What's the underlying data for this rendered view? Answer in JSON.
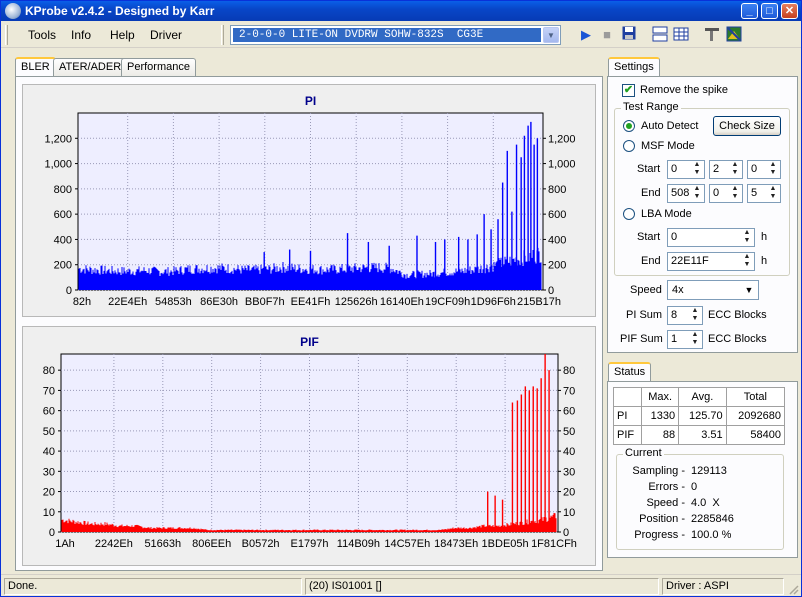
{
  "window": {
    "title": "KProbe v2.4.2 - Designed by Karr",
    "min": "_",
    "max": "□",
    "close": "✕"
  },
  "menu": {
    "items": [
      "Tools",
      "Info",
      "Help",
      "Driver"
    ]
  },
  "drive": {
    "selected": "2-0-0-0 LITE-ON DVDRW SOHW-832S  CG3E"
  },
  "toolbar": {
    "icons": [
      "play-icon",
      "stop-icon",
      "save-icon",
      "layout-icon",
      "grid-icon",
      "tools-icon",
      "image-icon"
    ]
  },
  "tabs": [
    "BLER",
    "ATER/ADER",
    "Performance"
  ],
  "chart_data": [
    {
      "type": "bar",
      "title": "PI",
      "x_tick_labels": [
        "82h",
        "22E4Eh",
        "54853h",
        "86E30h",
        "BB0F7h",
        "EE41Fh",
        "125626h",
        "16140Eh",
        "19CF09h",
        "1D96F6h",
        "215B17h"
      ],
      "ylim": [
        0,
        1400
      ],
      "y_ticks": [
        0,
        200,
        400,
        600,
        800,
        1000,
        1200
      ],
      "y_tick_labels": [
        "0",
        "200",
        "400",
        "600",
        "800",
        "1,000",
        "1,200"
      ],
      "color": "#0000FF",
      "baseline": [
        170,
        160,
        155,
        150,
        150,
        155,
        145,
        150,
        165,
        170,
        175,
        170,
        160,
        160,
        165,
        180,
        170,
        165,
        160,
        165,
        170,
        175,
        178,
        170,
        120,
        125,
        130,
        140,
        150,
        160,
        180,
        210,
        240,
        260,
        290
      ],
      "spikes": [
        {
          "x": 0.4,
          "v": 300
        },
        {
          "x": 0.455,
          "v": 320
        },
        {
          "x": 0.5,
          "v": 310
        },
        {
          "x": 0.58,
          "v": 450
        },
        {
          "x": 0.625,
          "v": 380
        },
        {
          "x": 0.67,
          "v": 350
        },
        {
          "x": 0.73,
          "v": 430
        },
        {
          "x": 0.77,
          "v": 380
        },
        {
          "x": 0.79,
          "v": 400
        },
        {
          "x": 0.82,
          "v": 420
        },
        {
          "x": 0.84,
          "v": 400
        },
        {
          "x": 0.86,
          "v": 440
        },
        {
          "x": 0.875,
          "v": 600
        },
        {
          "x": 0.89,
          "v": 480
        },
        {
          "x": 0.905,
          "v": 560
        },
        {
          "x": 0.915,
          "v": 850
        },
        {
          "x": 0.925,
          "v": 1100
        },
        {
          "x": 0.935,
          "v": 620
        },
        {
          "x": 0.945,
          "v": 1150
        },
        {
          "x": 0.955,
          "v": 1050
        },
        {
          "x": 0.962,
          "v": 1220
        },
        {
          "x": 0.97,
          "v": 1300
        },
        {
          "x": 0.976,
          "v": 1330
        },
        {
          "x": 0.983,
          "v": 1150
        },
        {
          "x": 0.99,
          "v": 1200
        }
      ]
    },
    {
      "type": "bar",
      "title": "PIF",
      "x_tick_labels": [
        "1Ah",
        "2242Eh",
        "51663h",
        "806EEh",
        "B0572h",
        "E1797h",
        "114B09h",
        "14C57Eh",
        "18473Eh",
        "1BDE05h",
        "1F81CFh"
      ],
      "ylim": [
        0,
        88
      ],
      "y_ticks": [
        0,
        10,
        20,
        30,
        40,
        50,
        60,
        70,
        80
      ],
      "y_tick_labels": [
        "0",
        "10",
        "20",
        "30",
        "40",
        "50",
        "60",
        "70",
        "80"
      ],
      "color": "#FF0000",
      "baseline": [
        6,
        5,
        4,
        4,
        3,
        3,
        2,
        2,
        2,
        2,
        1,
        1,
        1,
        1,
        1,
        1,
        1,
        1,
        1,
        1,
        1,
        1,
        1,
        1,
        1,
        1,
        1,
        2,
        2,
        3,
        3,
        4,
        5,
        6,
        8
      ],
      "spikes": [
        {
          "x": 0.86,
          "v": 20
        },
        {
          "x": 0.875,
          "v": 18
        },
        {
          "x": 0.89,
          "v": 16
        },
        {
          "x": 0.91,
          "v": 64
        },
        {
          "x": 0.92,
          "v": 65
        },
        {
          "x": 0.928,
          "v": 68
        },
        {
          "x": 0.936,
          "v": 72
        },
        {
          "x": 0.944,
          "v": 70
        },
        {
          "x": 0.952,
          "v": 72
        },
        {
          "x": 0.96,
          "v": 71
        },
        {
          "x": 0.968,
          "v": 76
        },
        {
          "x": 0.976,
          "v": 88
        },
        {
          "x": 0.984,
          "v": 80
        }
      ]
    }
  ],
  "settings": {
    "title": "Settings",
    "remove_spike": "Remove the spike",
    "test_range": "Test Range",
    "auto_detect": "Auto Detect",
    "check_size": "Check Size",
    "msf_mode": "MSF Mode",
    "start_label": "Start",
    "end_label": "End",
    "msf_start": [
      "0",
      "2",
      "0"
    ],
    "msf_end": [
      "508",
      "0",
      "5"
    ],
    "lba_mode": "LBA Mode",
    "lba_start": "0",
    "lba_end": "22E11F",
    "h": "h",
    "speed_label": "Speed",
    "speed_value": "4x",
    "pi_sum_label": "PI Sum",
    "pi_sum_value": "8",
    "pif_sum_label": "PIF Sum",
    "pif_sum_value": "1",
    "ecc_blocks": "ECC Blocks"
  },
  "status": {
    "title": "Status",
    "headers": [
      "",
      "Max.",
      "Avg.",
      "Total"
    ],
    "rows": [
      [
        "PI",
        "1330",
        "125.70",
        "2092680"
      ],
      [
        "PIF",
        "88",
        "3.51",
        "58400"
      ]
    ],
    "current_title": "Current",
    "current": [
      {
        "label": "Sampling -",
        "value": "129113"
      },
      {
        "label": "Errors -",
        "value": "0"
      },
      {
        "label": "Speed -",
        "value": "4.0  X"
      },
      {
        "label": "Position -",
        "value": "2285846"
      },
      {
        "label": "Progress -",
        "value": "100.0 %"
      }
    ]
  },
  "statusbar": {
    "left": "Done.",
    "middle": "(20) IS01001 []",
    "right": "Driver : ASPI"
  }
}
